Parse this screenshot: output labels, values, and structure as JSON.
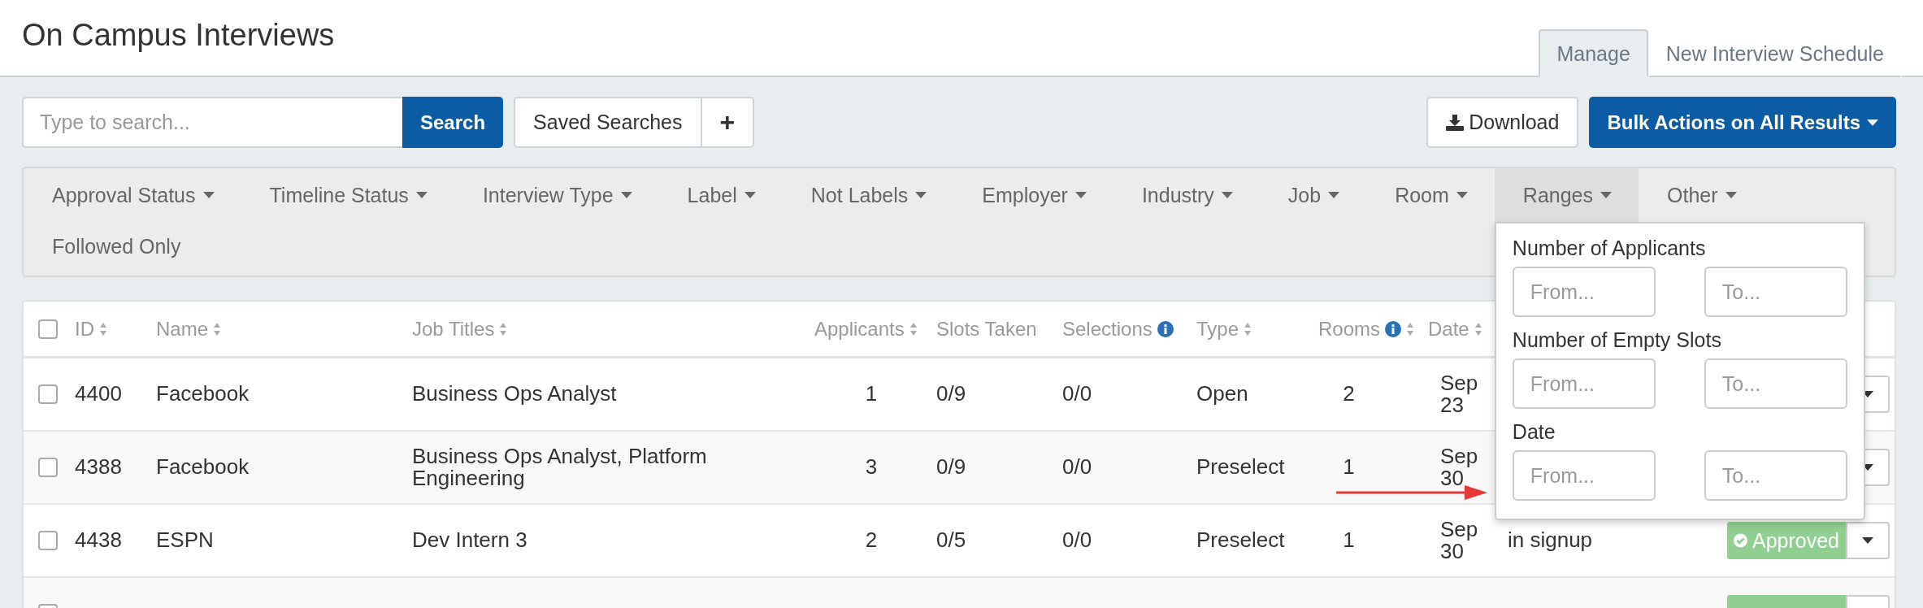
{
  "page_title": "On Campus Interviews",
  "tabs": [
    {
      "label": "Manage",
      "selected": true
    },
    {
      "label": "New Interview Schedule",
      "selected": false
    }
  ],
  "search": {
    "placeholder": "Type to search...",
    "button": "Search"
  },
  "saved_searches": {
    "label": "Saved Searches",
    "add": "+"
  },
  "actions": {
    "download": "Download",
    "bulk": "Bulk Actions on All Results"
  },
  "filters": [
    {
      "label": "Approval Status",
      "selected": false
    },
    {
      "label": "Timeline Status",
      "selected": false
    },
    {
      "label": "Interview Type",
      "selected": false
    },
    {
      "label": "Label",
      "selected": false
    },
    {
      "label": "Not Labels",
      "selected": false
    },
    {
      "label": "Employer",
      "selected": false
    },
    {
      "label": "Industry",
      "selected": false
    },
    {
      "label": "Job",
      "selected": false
    },
    {
      "label": "Room",
      "selected": false
    },
    {
      "label": "Ranges",
      "selected": true
    },
    {
      "label": "Other",
      "selected": false
    }
  ],
  "followed_only": "Followed Only",
  "ranges_dropdown": [
    {
      "label": "Number of Applicants",
      "from": {
        "placeholder": "From..."
      },
      "to": {
        "placeholder": "To..."
      }
    },
    {
      "label": "Number of Empty Slots",
      "from": {
        "placeholder": "From..."
      },
      "to": {
        "placeholder": "To..."
      }
    },
    {
      "label": "Date",
      "from": {
        "placeholder": "From..."
      },
      "to": {
        "placeholder": "To..."
      }
    }
  ],
  "table": {
    "select_all_checked": false,
    "columns": [
      {
        "label": "ID",
        "sort": true,
        "info": false
      },
      {
        "label": "Name",
        "sort": true,
        "info": false
      },
      {
        "label": "Job Titles",
        "sort": true,
        "info": false
      },
      {
        "label": "Applicants",
        "sort": true,
        "info": false
      },
      {
        "label": "Slots Taken",
        "sort": false,
        "info": false
      },
      {
        "label": "Selections",
        "sort": false,
        "info": true
      },
      {
        "label": "Type",
        "sort": true,
        "info": false
      },
      {
        "label": "Rooms",
        "sort": true,
        "info": true
      },
      {
        "label": "Date",
        "sort": true,
        "info": false
      }
    ],
    "rows": [
      {
        "checked": false,
        "id": "4400",
        "name": "Facebook",
        "job_titles": "Business Ops Analyst",
        "applicants": "1",
        "slots_taken": "0/9",
        "selections": "0/0",
        "type": "Open",
        "rooms": "2",
        "date": "Sep 23"
      },
      {
        "checked": false,
        "id": "4388",
        "name": "Facebook",
        "job_titles": "Business Ops Analyst, Platform Engineering",
        "applicants": "3",
        "slots_taken": "0/9",
        "selections": "0/0",
        "type": "Preselect",
        "rooms": "1",
        "date": "Sep 30"
      },
      {
        "checked": false,
        "id": "4438",
        "name": "ESPN",
        "job_titles": "Dev Intern 3",
        "applicants": "2",
        "slots_taken": "0/5",
        "selections": "0/0",
        "type": "Preselect",
        "rooms": "1",
        "date": "Sep 30",
        "status": "in signup",
        "badge": {
          "kind": "approved",
          "label": "Approved"
        }
      },
      {
        "checked": false,
        "badge": {
          "kind": "approved"
        }
      }
    ]
  }
}
